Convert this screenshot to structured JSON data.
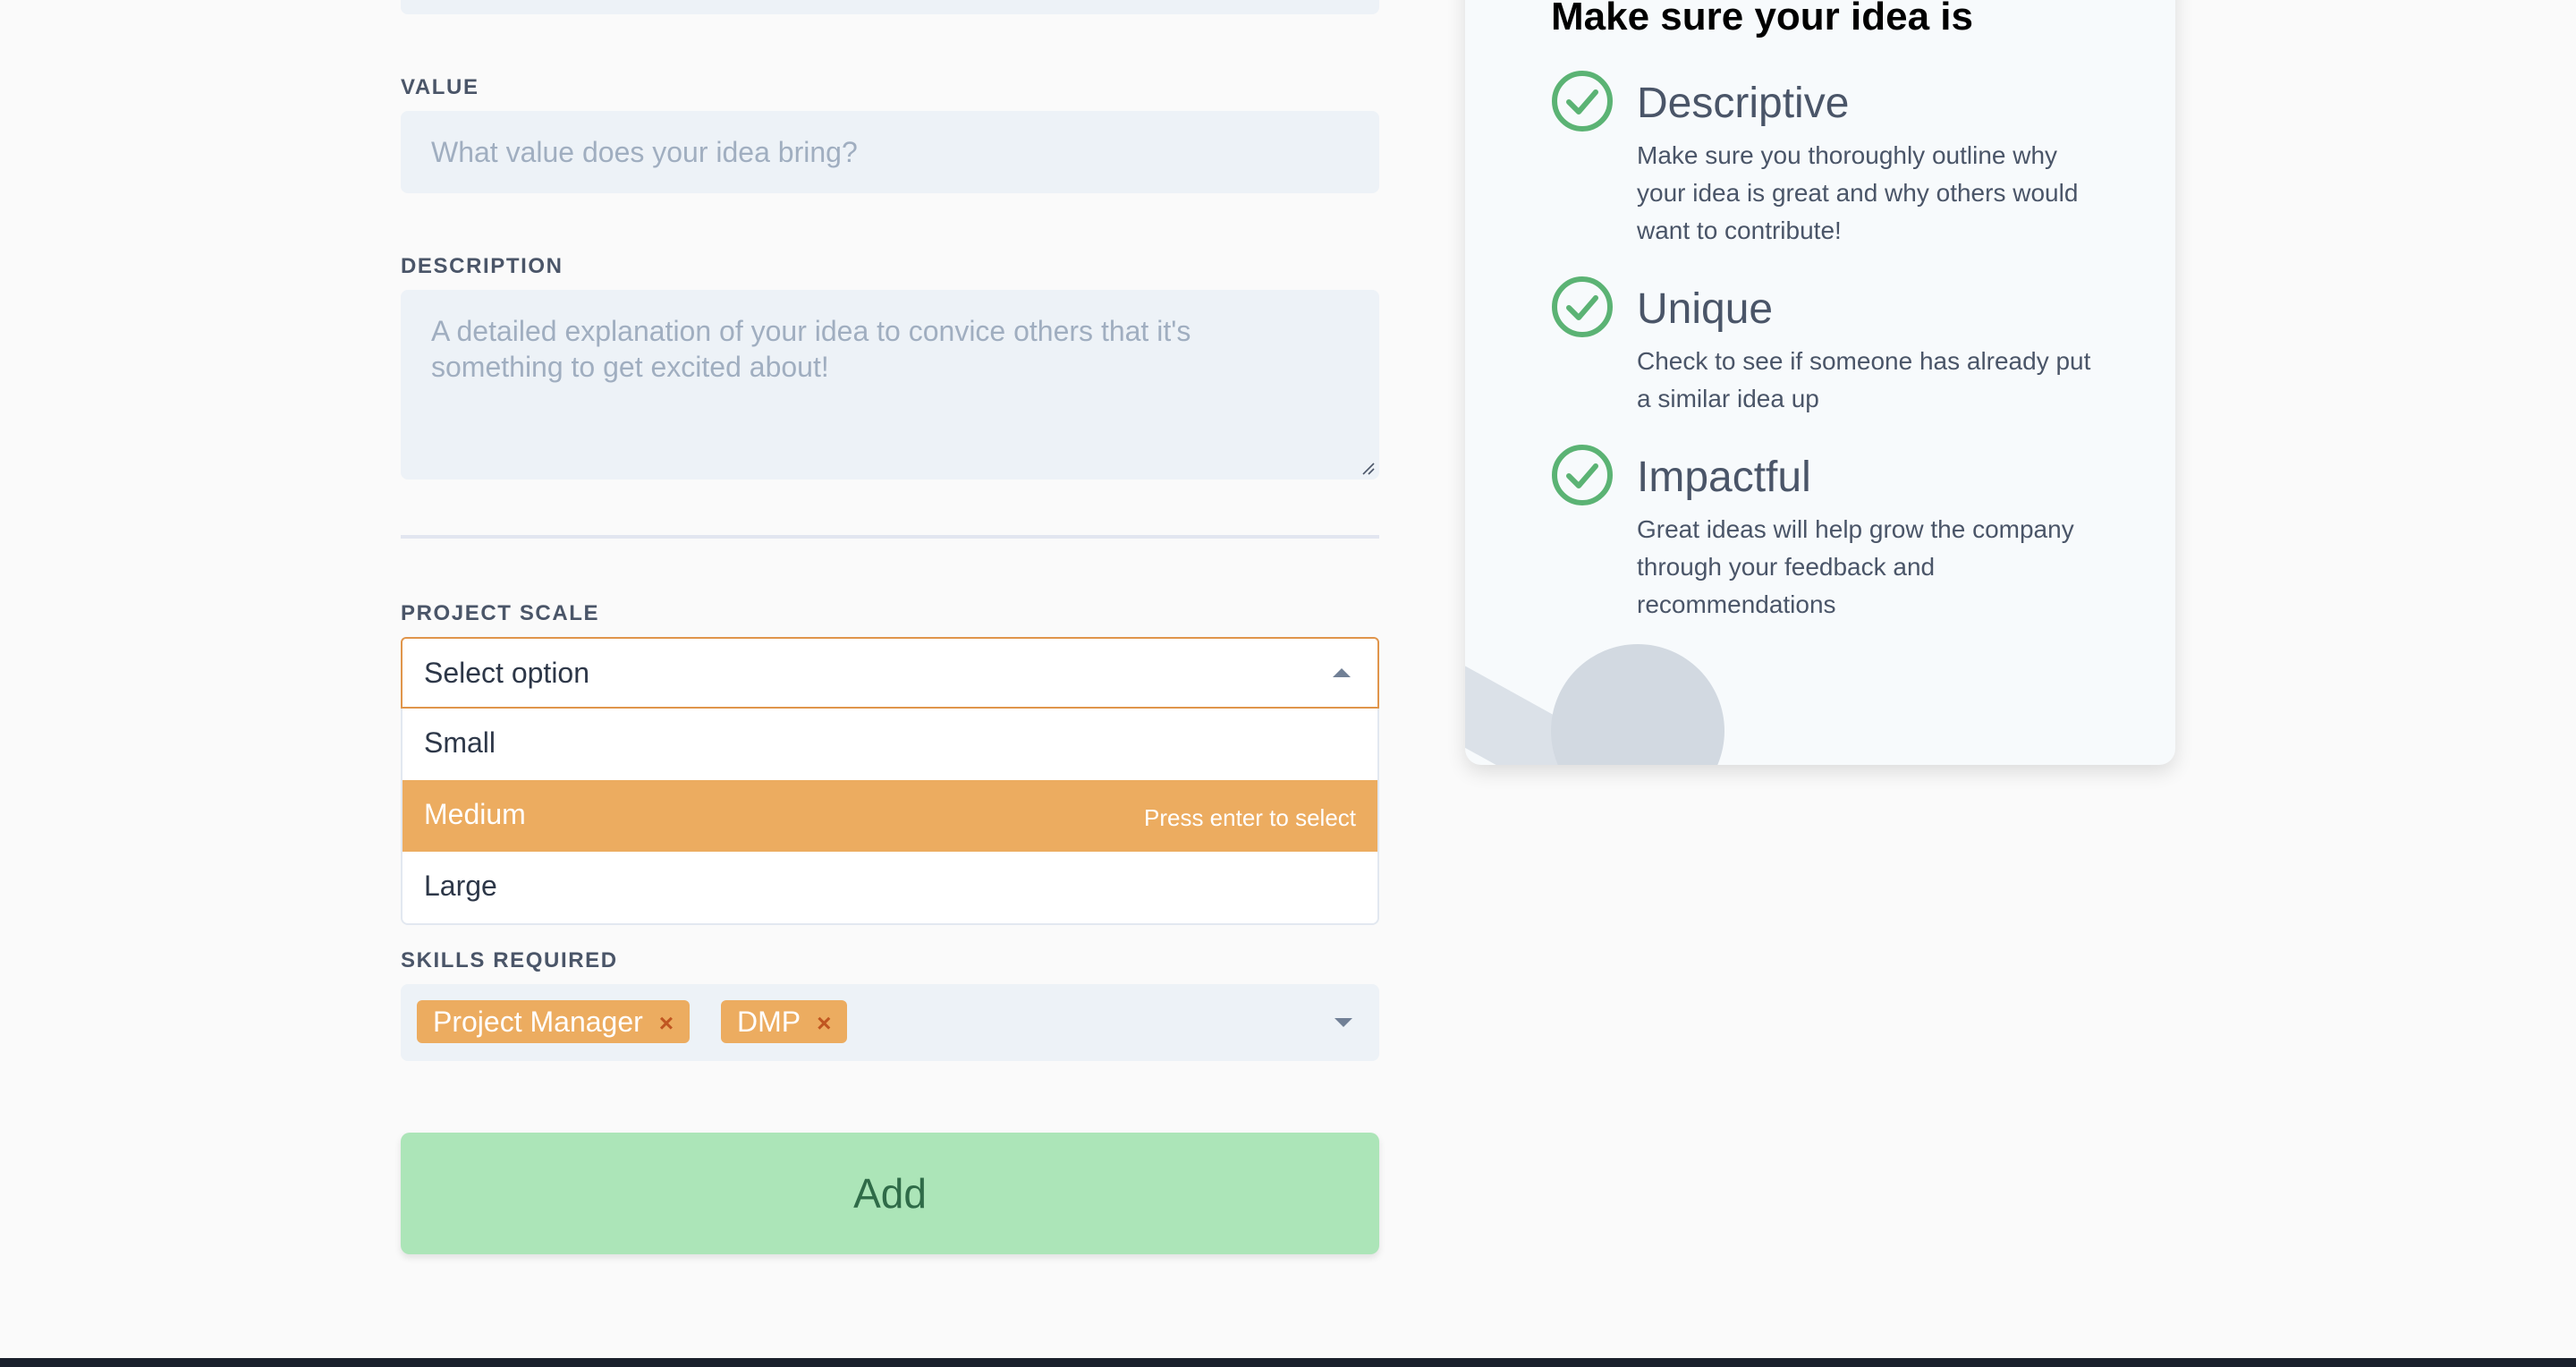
{
  "form": {
    "value": {
      "label": "VALUE",
      "placeholder": "What value does your idea bring?"
    },
    "description": {
      "label": "DESCRIPTION",
      "placeholder": "A detailed explanation of your idea to convice others that it's something to get excited about!"
    },
    "project_scale": {
      "label": "PROJECT SCALE",
      "selected": "Select option",
      "options": [
        "Small",
        "Medium",
        "Large"
      ],
      "highlighted_hint": "Press enter to select"
    },
    "skills": {
      "label": "SKILLS REQUIRED",
      "tags": [
        "Project Manager",
        "DMP"
      ],
      "remove_glyph": "×"
    },
    "submit_label": "Add"
  },
  "tips": {
    "title": "Make sure your idea is",
    "items": [
      {
        "title": "Descriptive",
        "text": "Make sure you thoroughly outline why your idea is great and why others would want to contribute!"
      },
      {
        "title": "Unique",
        "text": "Check to see if someone has already put a similar idea up"
      },
      {
        "title": "Impactful",
        "text": "Great ideas will help grow the company through your feedback and recommendations"
      }
    ]
  },
  "colors": {
    "accent": "#ecac60",
    "focus_border": "#e0954b",
    "success_button": "#ace5b8",
    "check_green": "#5bb374",
    "input_bg": "#edf2f7"
  },
  "icons": {
    "tip_check": "check-circle-icon",
    "select_open": "caret-up-icon",
    "select_closed": "caret-down-icon",
    "tag_remove": "close-icon"
  }
}
